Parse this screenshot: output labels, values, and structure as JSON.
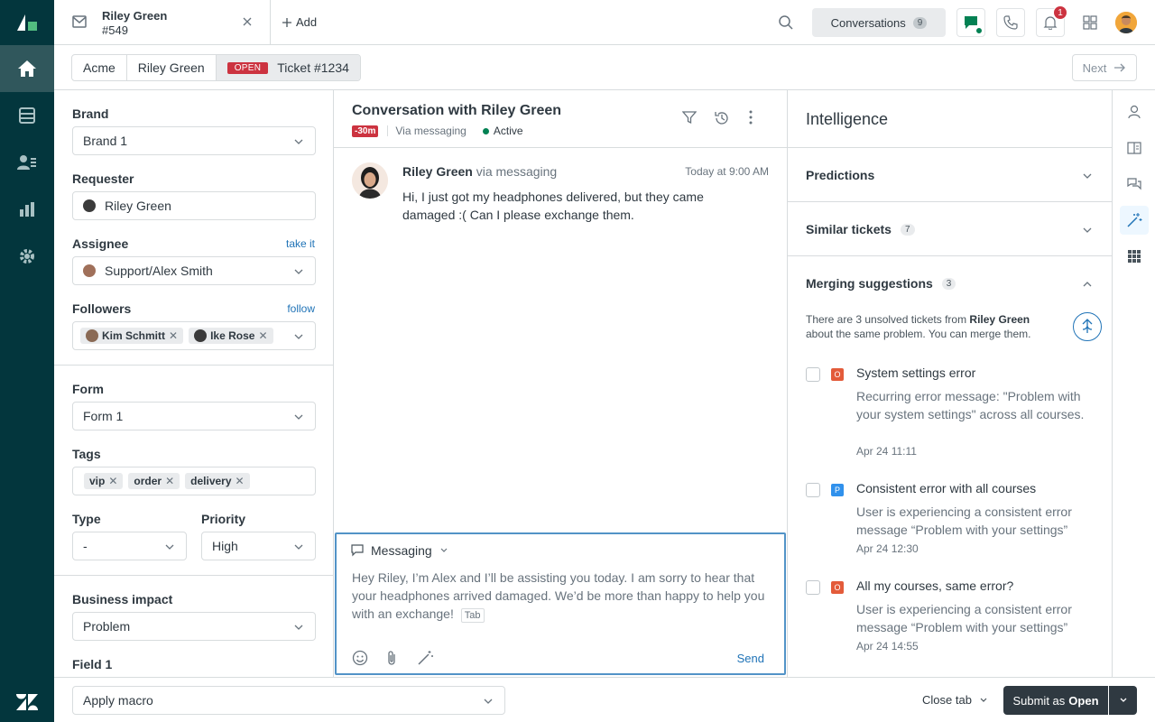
{
  "topbar": {
    "tab_name": "Riley Green",
    "tab_id": "#549",
    "add_label": "Add",
    "conversations_label": "Conversations",
    "conversations_count": "9",
    "notification_count": "1"
  },
  "breadcrumb": {
    "org": "Acme",
    "requester": "Riley Green",
    "status": "OPEN",
    "ticket": "Ticket #1234",
    "next_label": "Next"
  },
  "props": {
    "brand_label": "Brand",
    "brand_value": "Brand 1",
    "requester_label": "Requester",
    "requester_value": "Riley Green",
    "assignee_label": "Assignee",
    "assignee_link": "take it",
    "assignee_value": "Support/Alex Smith",
    "followers_label": "Followers",
    "followers_link": "follow",
    "followers": [
      "Kim Schmitt",
      "Ike Rose"
    ],
    "form_label": "Form",
    "form_value": "Form 1",
    "tags_label": "Tags",
    "tags": [
      "vip",
      "order",
      "delivery"
    ],
    "type_label": "Type",
    "type_value": "-",
    "priority_label": "Priority",
    "priority_value": "High",
    "impact_label": "Business impact",
    "impact_value": "Problem",
    "field1_label": "Field 1"
  },
  "conversation": {
    "title": "Conversation with Riley Green",
    "sla": "-30m",
    "via": "Via messaging",
    "status": "Active",
    "message": {
      "sender": "Riley Green",
      "via": "via messaging",
      "time": "Today at 9:00 AM",
      "body": "Hi, I just got my headphones delivered, but they came damaged :( Can I please exchange them."
    },
    "composer": {
      "channel": "Messaging",
      "text": "Hey Riley, I’m Alex and I’ll be assisting you today. I am sorry to hear that your headphones arrived damaged. We’d be more than happy to help you with an exchange!",
      "tab_hint": "Tab",
      "send_label": "Send"
    }
  },
  "intelligence": {
    "title": "Intelligence",
    "predictions_label": "Predictions",
    "similar_label": "Similar tickets",
    "similar_count": "7",
    "merging_label": "Merging suggestions",
    "merging_count": "3",
    "merge_note_pre": "There are 3 unsolved tickets from",
    "merge_note_name": "Riley Green",
    "merge_note_post": "about the same problem. You can merge them.",
    "suggestions": [
      {
        "status": "O",
        "status_color": "#e35b3a",
        "title": "System settings error",
        "desc": "Recurring error message: \"Problem with your system settings\" across all courses.",
        "date": "Apr 24 11:11"
      },
      {
        "status": "P",
        "status_color": "#3091ec",
        "title": "Consistent error with all courses",
        "desc": "User is experiencing a consistent error message “Problem with your settings”",
        "date": "Apr 24 12:30"
      },
      {
        "status": "O",
        "status_color": "#e35b3a",
        "title": "All my courses, same error?",
        "desc": "User is experiencing a consistent error message “Problem with your settings”",
        "date": "Apr 24 14:55"
      }
    ]
  },
  "bottombar": {
    "macro_label": "Apply macro",
    "close_tab_label": "Close tab",
    "submit_prefix": "Submit as",
    "submit_status": "Open"
  },
  "colors": {
    "nav_bg": "#03363d",
    "accent_blue": "#1f73b7",
    "open_red": "#cc3340",
    "active_green": "#038153"
  }
}
